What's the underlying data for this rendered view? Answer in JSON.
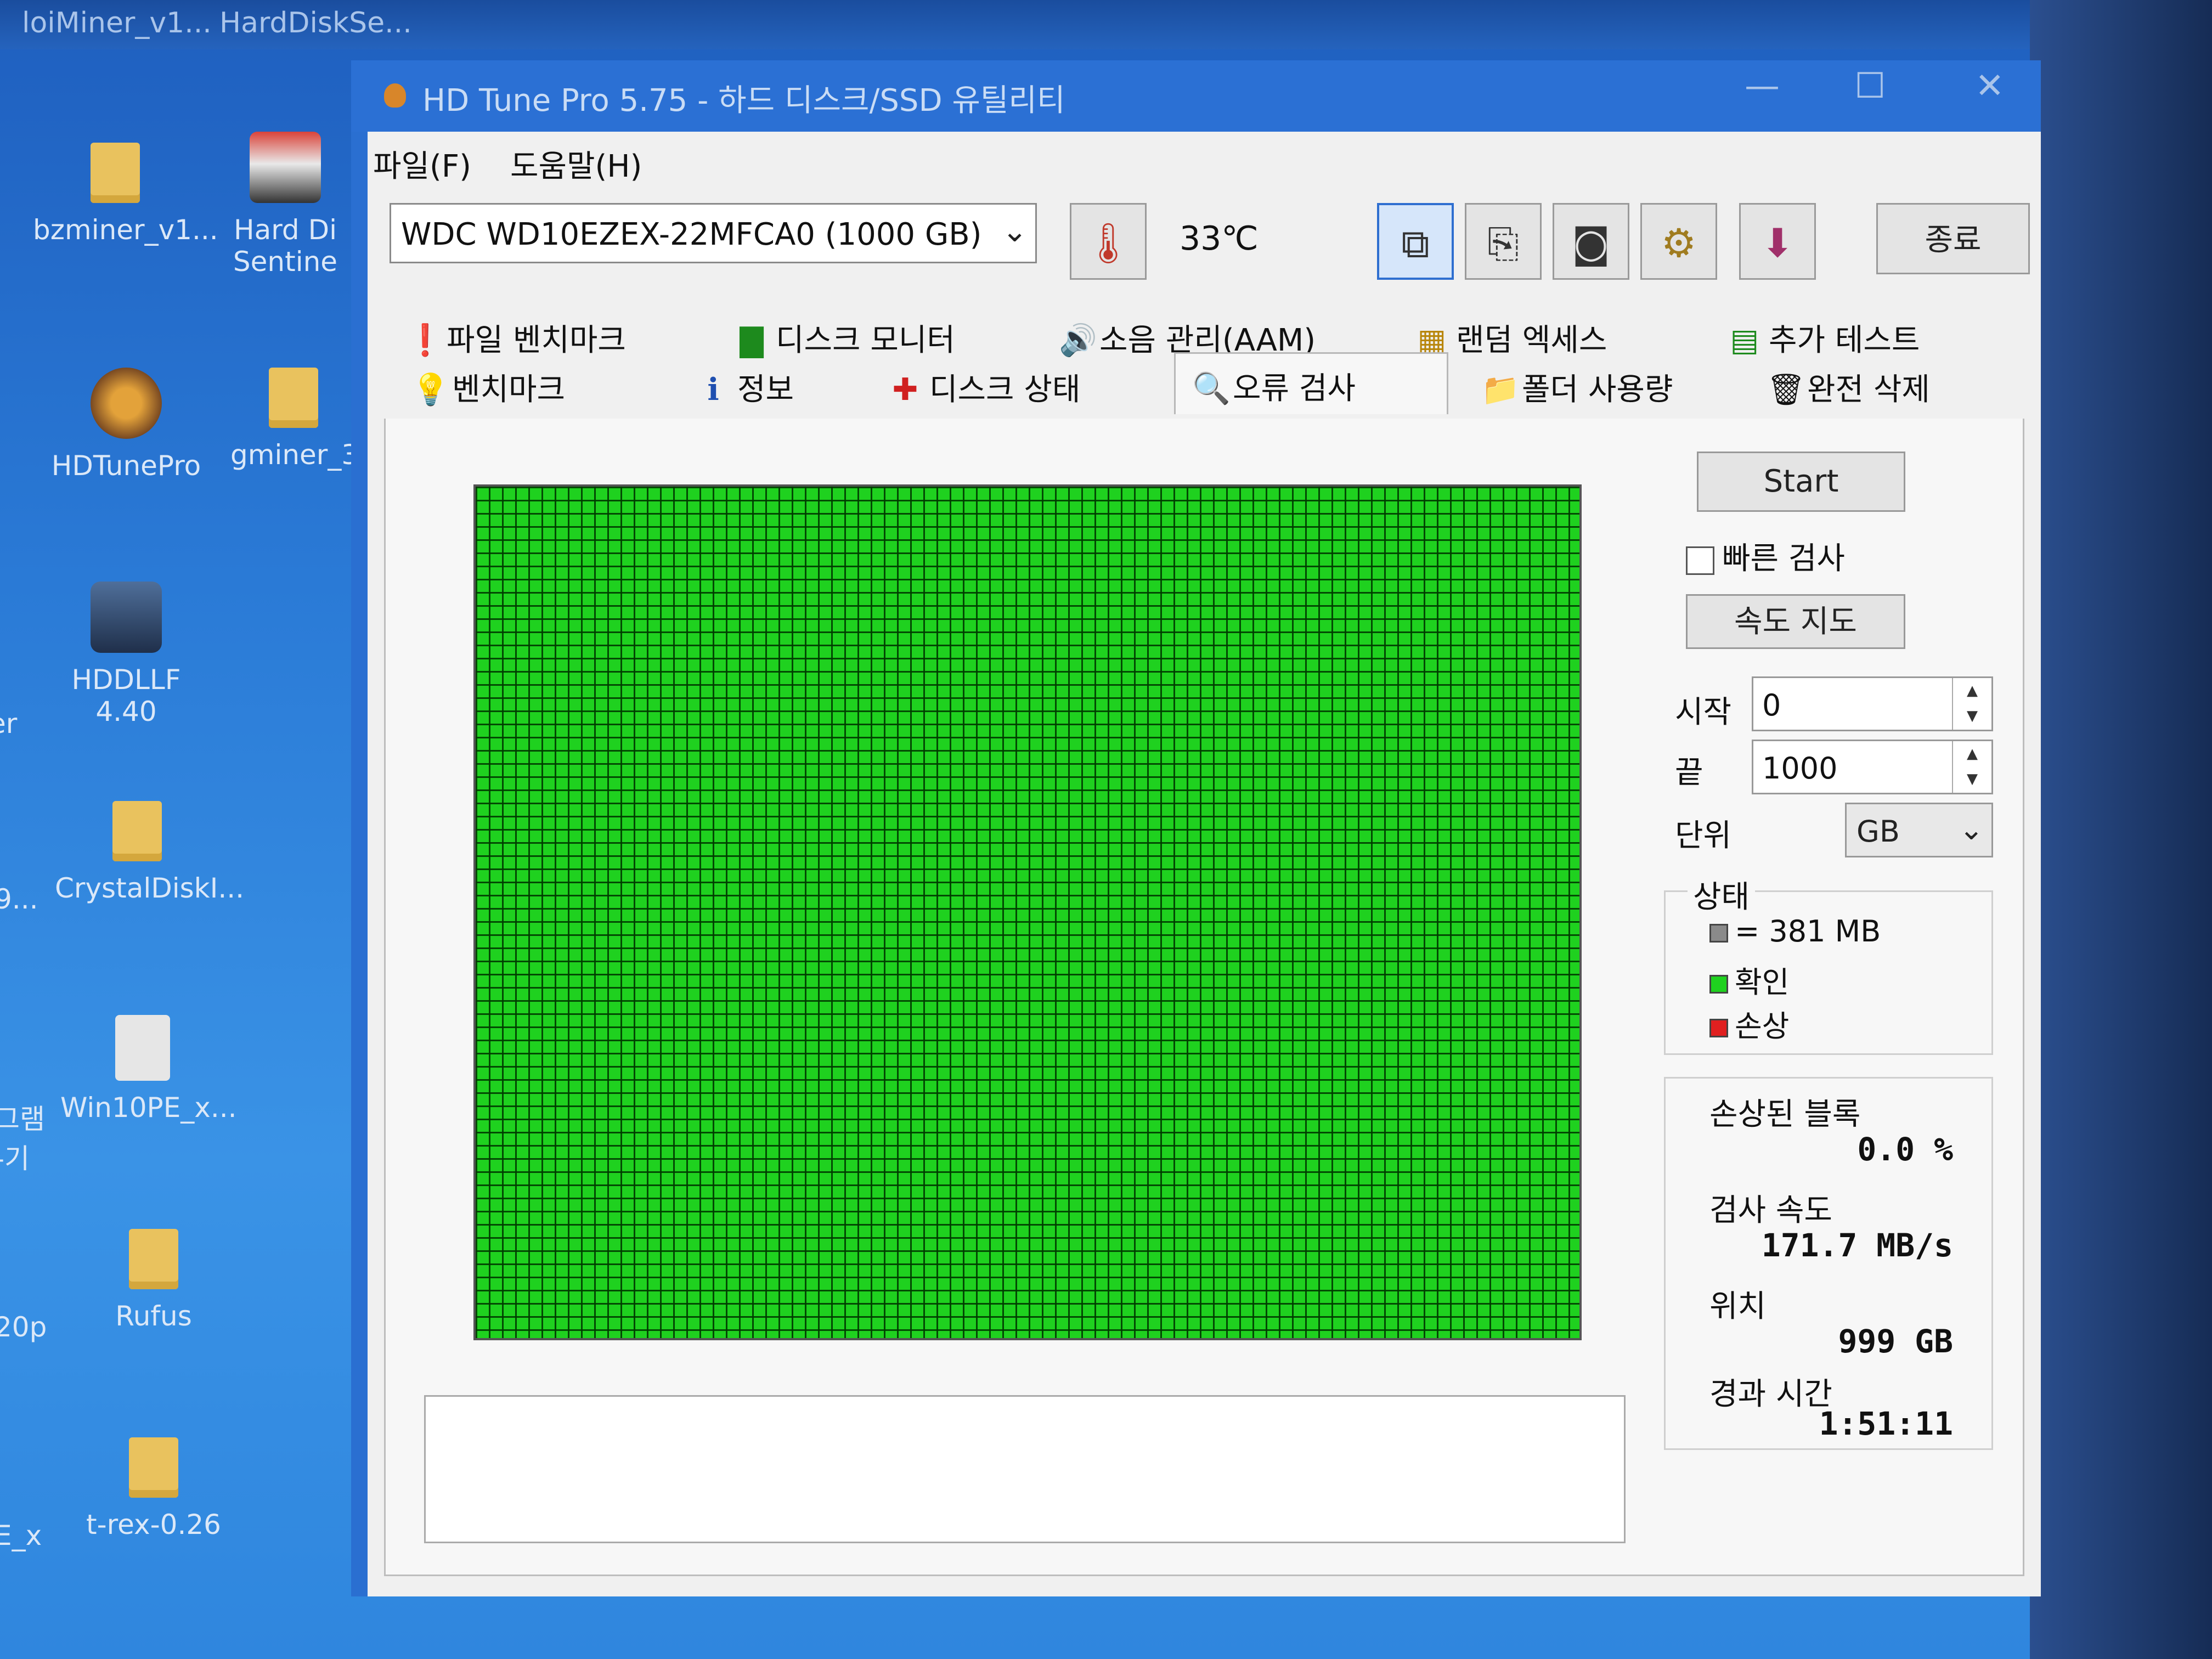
{
  "desktop": {
    "top_labels": [
      "loiMiner_v1...",
      "HardDiskSe..."
    ],
    "icons": [
      {
        "label": "bzminer_v1...",
        "type": "folder"
      },
      {
        "label": "Hard Di Sentine",
        "type": "app"
      },
      {
        "label": "HDTunePro",
        "type": "app"
      },
      {
        "label": "gminer_3",
        "type": "folder"
      },
      {
        "label": "HDDLLF 4.40",
        "type": "app"
      },
      {
        "label": "CrystalDiskI...",
        "type": "folder"
      },
      {
        "label": "Win10PE_x...",
        "type": "disc"
      },
      {
        "label": "Rufus",
        "type": "folder"
      },
      {
        "label": "t-rex-0.26",
        "type": "folder"
      }
    ],
    "edge_labels": [
      "er",
      "9...",
      "그램 -기",
      "20p",
      "E_x"
    ]
  },
  "window": {
    "title": "HD Tune Pro 5.75 - 하드 디스크/SSD 유틸리티",
    "controls": {
      "minimize": "—",
      "maximize": "☐",
      "close": "✕"
    }
  },
  "menu": {
    "file": "파일(F)",
    "help": "도움말(H)"
  },
  "toolbar": {
    "drive": "WDC WD10EZEX-22MFCA0 (1000 GB)",
    "temperature": "33℃",
    "exit_label": "종료"
  },
  "tabs": {
    "row1": [
      {
        "label": "파일 벤치마크",
        "icon": "file-benchmark-icon"
      },
      {
        "label": "디스크 모니터",
        "icon": "disk-monitor-icon"
      },
      {
        "label": "소음 관리(AAM)",
        "icon": "speaker-icon"
      },
      {
        "label": "랜덤 엑세스",
        "icon": "random-access-icon"
      },
      {
        "label": "추가 테스트",
        "icon": "extra-tests-icon"
      }
    ],
    "row2": [
      {
        "label": "벤치마크",
        "icon": "benchmark-icon"
      },
      {
        "label": "정보",
        "icon": "info-icon"
      },
      {
        "label": "디스크 상태",
        "icon": "health-cross-icon"
      },
      {
        "label": "오류 검사",
        "icon": "magnifier-icon"
      },
      {
        "label": "폴더 사용량",
        "icon": "folder-icon"
      },
      {
        "label": "완전 삭제",
        "icon": "trash-icon"
      }
    ],
    "selected": "오류 검사"
  },
  "error_scan": {
    "start_label": "Start",
    "quick_scan_label": "빠른 검사",
    "quick_scan_checked": false,
    "speed_map_label": "속도 지도",
    "start_field_label": "시작",
    "start_value": "0",
    "end_field_label": "끝",
    "end_value": "1000",
    "unit_label": "단위",
    "unit_value": "GB",
    "status_title": "상태",
    "legend": {
      "block": "= 381 MB",
      "ok": "확인",
      "damaged": "손상"
    },
    "damaged_blocks_label": "손상된 블록",
    "damaged_blocks_value": "0.0 %",
    "scan_speed_label": "검사 속도",
    "scan_speed_value": "171.7 MB/s",
    "position_label": "위치",
    "position_value": "999 GB",
    "elapsed_label": "경과 시간",
    "elapsed_value": "1:51:11"
  },
  "colors": {
    "ok_block": "#1fd11f",
    "damaged_block": "#e02020",
    "pending_block": "#8a8a8a",
    "window_chrome": "#2b70d4"
  }
}
